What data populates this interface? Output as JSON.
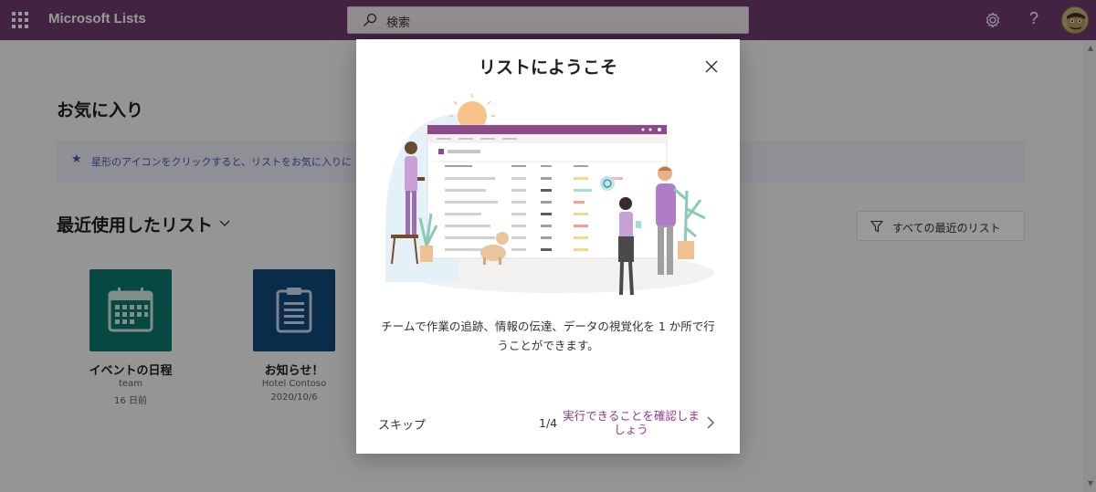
{
  "topbar": {
    "app_title": "Microsoft Lists",
    "search_placeholder": "検索",
    "help_label": "?"
  },
  "main": {
    "favorites_heading": "お気に入り",
    "favorites_banner": "星形のアイコンをクリックすると、リストをお気に入りに",
    "recent_heading": "最近使用したリスト",
    "filter_label": "すべての最近のリスト",
    "cards": [
      {
        "title": "イベントの日程",
        "subtitle": "team",
        "date": "16 日前",
        "color": "#0a7a6e"
      },
      {
        "title": "お知らせ！",
        "subtitle": "Hotel Contoso",
        "date": "2020/10/6",
        "color": "#0f4a7d"
      }
    ]
  },
  "dialog": {
    "title": "リストにようこそ",
    "description": "チームで作業の追跡、情報の伝達、データの視覚化を 1 か所で行うことができます。",
    "skip_label": "スキップ",
    "page_indicator": "1/4",
    "next_label": "実行できることを確認しましょう"
  },
  "colors": {
    "brand": "#703b6e",
    "accent_link": "#8c3a8b"
  }
}
